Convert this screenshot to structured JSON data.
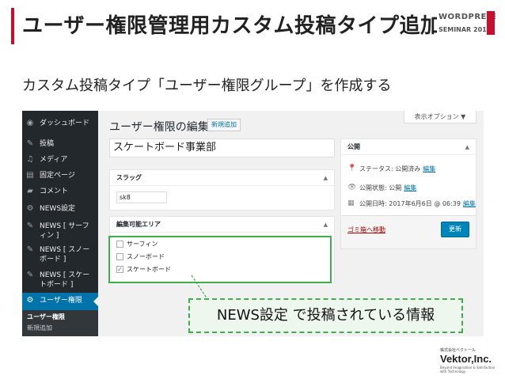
{
  "slide": {
    "title": "ユーザー権限管理用カスタム投稿タイプ追加",
    "subtitle": "カスタム投稿タイプ「ユーザー権限グループ」を作成する",
    "accent_color": "#c8102e",
    "event_logo": {
      "line1": "WORDPRESS",
      "line2": "SEMINAR 2017",
      "icon": "wordcamp-logo-icon"
    },
    "company_logo": {
      "small": "株式会社ベクトール",
      "name": "Vektor,Inc.",
      "tagline": "Beyond Imagination & Satisfaction with Technology"
    }
  },
  "wp": {
    "sidebar": {
      "items": [
        {
          "label": "ダッシュボード",
          "icon": "dashboard-icon"
        },
        {
          "label": "投稿",
          "icon": "pin-icon"
        },
        {
          "label": "メディア",
          "icon": "media-icon"
        },
        {
          "label": "固定ページ",
          "icon": "page-icon"
        },
        {
          "label": "コメント",
          "icon": "comment-icon"
        },
        {
          "label": "NEWS設定",
          "icon": "gear-icon"
        },
        {
          "label": "NEWS [ サーフィン ]",
          "icon": "pin-icon"
        },
        {
          "label": "NEWS [ スノーボード ]",
          "icon": "pin-icon"
        },
        {
          "label": "NEWS [ スケートボード ]",
          "icon": "pin-icon"
        },
        {
          "label": "ユーザー権限",
          "icon": "gear-icon"
        }
      ],
      "submenu": [
        "ユーザー権限",
        "新規追加"
      ],
      "active_color": "#0073aa"
    },
    "screen_options": "表示オプション ▼",
    "page_heading": "ユーザー権限の編集",
    "add_new": "新規追加",
    "post_title": "スケートボード事業部",
    "slug_box": {
      "heading": "スラッグ",
      "value": "sk8"
    },
    "area_box": {
      "heading": "編集可能エリア",
      "options": [
        {
          "label": "サーフィン",
          "checked": false
        },
        {
          "label": "スノーボード",
          "checked": false
        },
        {
          "label": "スケートボード",
          "checked": true
        }
      ]
    },
    "publish_box": {
      "heading": "公開",
      "status_label": "ステータス: 公開済み",
      "status_edit": "編集",
      "visibility_label": "公開状態: 公開",
      "visibility_edit": "編集",
      "date_label": "公開日時: 2017年6月6日 @ 06:39",
      "date_edit": "編集",
      "trash": "ゴミ箱へ移動",
      "update": "更新"
    }
  },
  "annotation": {
    "callout": "NEWS設定 で投稿されている情報",
    "color": "#3eaf4d"
  }
}
